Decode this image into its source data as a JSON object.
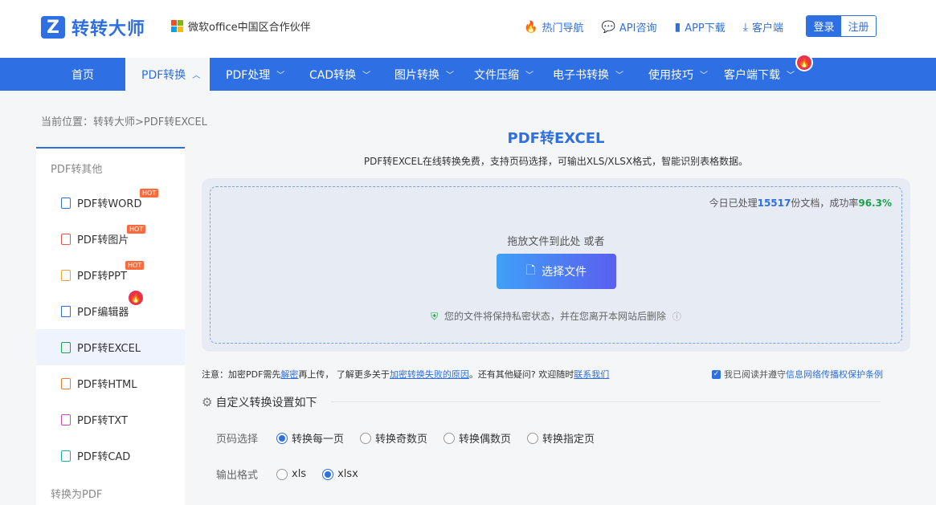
{
  "header": {
    "logo_glyph": "Z",
    "logo_text": "转转大师",
    "partner_text": "微软office中国区合作伙伴",
    "links": [
      {
        "icon": "fire-icon",
        "label": "热门导航"
      },
      {
        "icon": "chat-icon",
        "label": "API咨询"
      },
      {
        "icon": "phone-icon",
        "label": "APP下载"
      },
      {
        "icon": "download-icon",
        "label": "客户端"
      }
    ],
    "login_label": "登录",
    "register_label": "注册"
  },
  "nav": {
    "items": [
      {
        "label": "首页"
      },
      {
        "label": "PDF转换",
        "active": true
      },
      {
        "label": "PDF处理"
      },
      {
        "label": "CAD转换"
      },
      {
        "label": "图片转换"
      },
      {
        "label": "文件压缩"
      },
      {
        "label": "电子书转换"
      },
      {
        "label": "使用技巧"
      },
      {
        "label": "客户端下载"
      }
    ]
  },
  "breadcrumb": "当前位置：转转大师>PDF转EXCEL",
  "sidebar": {
    "group1": "PDF转其他",
    "items": [
      {
        "label": "PDF转WORD",
        "badge": "HOT"
      },
      {
        "label": "PDF转图片",
        "badge": "HOT"
      },
      {
        "label": "PDF转PPT",
        "badge": "HOT"
      },
      {
        "label": "PDF编辑器"
      },
      {
        "label": "PDF转EXCEL",
        "active": true
      },
      {
        "label": "PDF转HTML"
      },
      {
        "label": "PDF转TXT"
      },
      {
        "label": "PDF转CAD"
      }
    ],
    "group2": "转换为PDF"
  },
  "main": {
    "title": "PDF转EXCEL",
    "subtitle": "PDF转EXCEL在线转换免费，支持页码选择，可输出XLS/XLSX格式，智能识别表格数据。",
    "stats_prefix": "今日已处理",
    "stats_count": "15517",
    "stats_mid": "份文档，成功率",
    "stats_rate": "96.3%",
    "drag_hint": "拖放文件到此处 或者",
    "choose_label": "选择文件",
    "privacy_text": "您的文件将保持私密状态，并在您离开本网站后删除"
  },
  "notice": {
    "p1": "注意：加密PDF需先",
    "link1": "解密",
    "p2": "再上传， 了解更多关于",
    "link2": "加密转换失败的原因",
    "p3": "。还有其他疑问? 欢迎随时",
    "link3": "联系我们"
  },
  "agree": {
    "prefix": "我已阅读并遵守",
    "link": "信息网络传播权保护条例"
  },
  "settings": {
    "heading": "自定义转换设置如下",
    "page_label": "页码选择",
    "page_options": [
      "转换每一页",
      "转换奇数页",
      "转换偶数页",
      "转换指定页"
    ],
    "page_selected": 0,
    "format_label": "输出格式",
    "format_options": [
      "xls",
      "xlsx"
    ],
    "format_selected": 1
  },
  "colors": {
    "primary": "#2f6fe4",
    "hot": "#ff6a3d",
    "fire": "#e8334a",
    "success": "#1aa34a"
  }
}
